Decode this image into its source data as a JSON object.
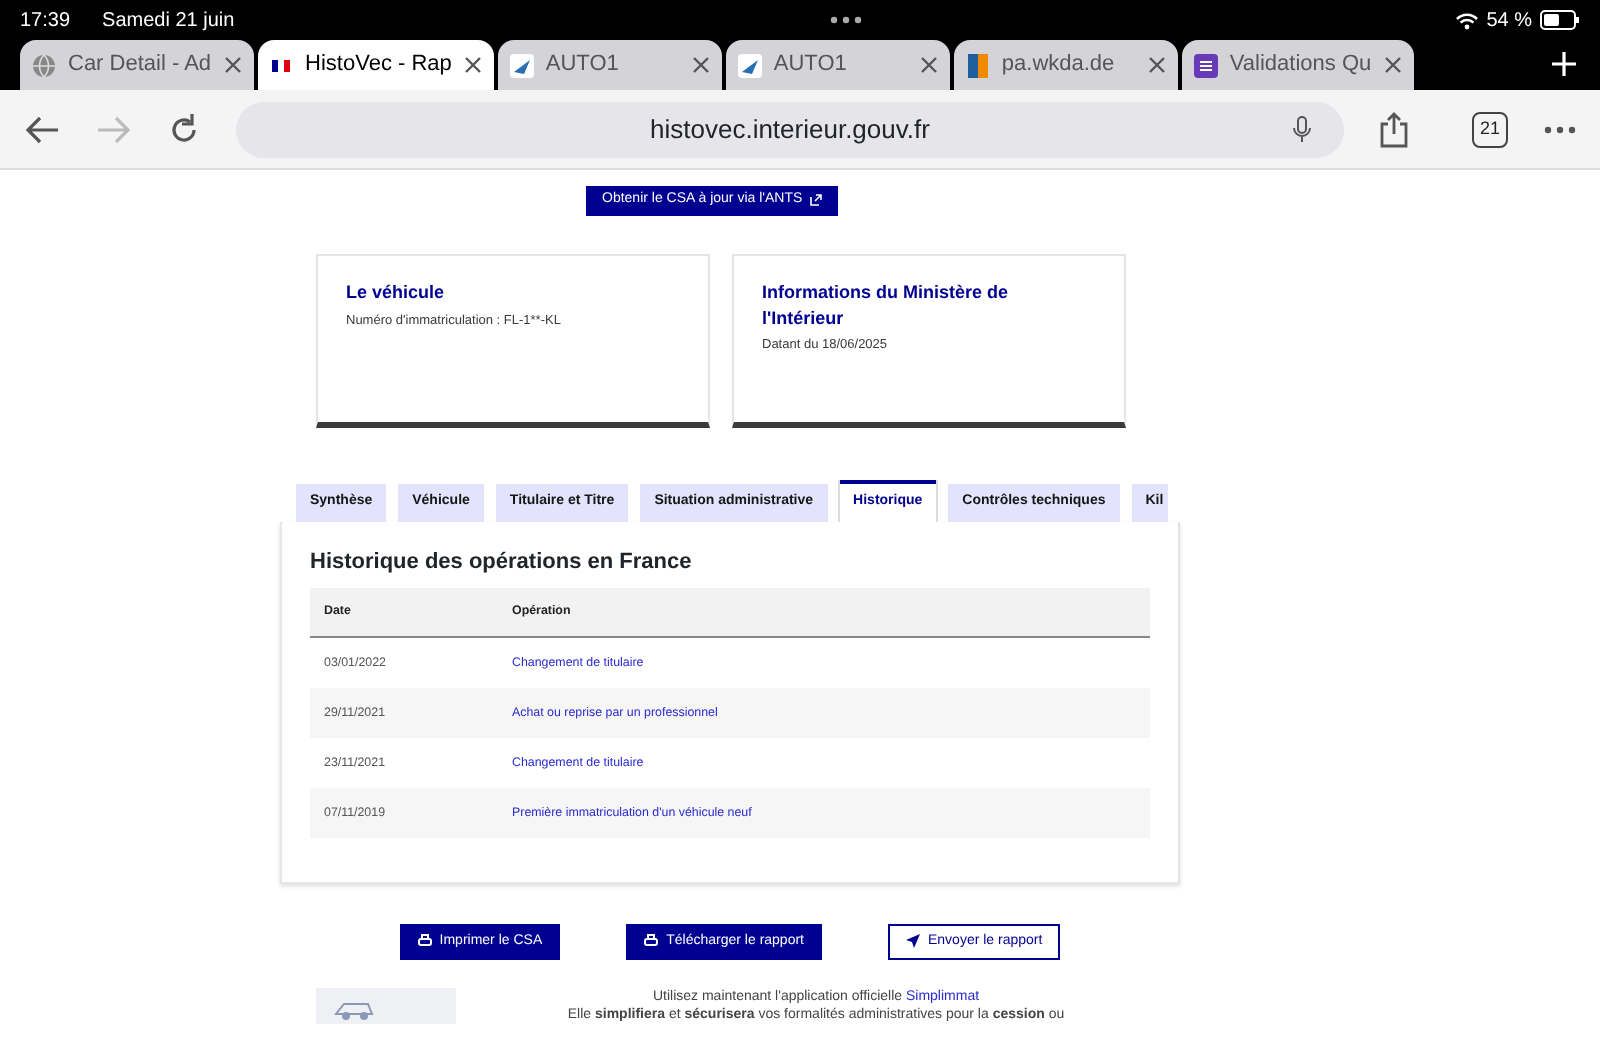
{
  "status_bar": {
    "time": "17:39",
    "date": "Samedi 21 juin",
    "battery": "54 %"
  },
  "browser_tabs": [
    {
      "title": "Car Detail - Ad",
      "selected": false,
      "kind": "globe"
    },
    {
      "title": "HistoVec - Rap",
      "selected": true,
      "kind": "flag"
    },
    {
      "title": "AUTO1",
      "selected": false,
      "kind": "auto"
    },
    {
      "title": "AUTO1",
      "selected": false,
      "kind": "auto"
    },
    {
      "title": "pa.wkda.de",
      "selected": false,
      "kind": "wkda"
    },
    {
      "title": "Validations Qu",
      "selected": false,
      "kind": "forms"
    }
  ],
  "address_bar": {
    "url": "histovec.interieur.gouv.fr",
    "tab_count": "21"
  },
  "ants_button": "Obtenir le CSA à jour via l'ANTS",
  "cards": [
    {
      "title": "Le véhicule",
      "text": "Numéro d'immatriculation : FL-1**-KL"
    },
    {
      "title": "Informations du Ministère de l'Intérieur",
      "text": "Datant du 18/06/2025"
    }
  ],
  "section_tabs": [
    {
      "label": "Synthèse",
      "selected": false
    },
    {
      "label": "Véhicule",
      "selected": false
    },
    {
      "label": "Titulaire et Titre",
      "selected": false
    },
    {
      "label": "Situation administrative",
      "selected": false
    },
    {
      "label": "Historique",
      "selected": true
    },
    {
      "label": "Contrôles techniques",
      "selected": false
    },
    {
      "label": "Kil",
      "selected": false
    }
  ],
  "history": {
    "title": "Historique des opérations en France",
    "columns": [
      "Date",
      "Opération"
    ],
    "rows": [
      {
        "date": "03/01/2022",
        "operation": "Changement de titulaire"
      },
      {
        "date": "29/11/2021",
        "operation": "Achat ou reprise par un professionnel"
      },
      {
        "date": "23/11/2021",
        "operation": "Changement de titulaire"
      },
      {
        "date": "07/11/2019",
        "operation": "Première immatriculation d'un véhicule neuf"
      }
    ]
  },
  "actions": [
    {
      "label": "Imprimer le CSA",
      "kind": "print"
    },
    {
      "label": "Télécharger le rapport",
      "kind": "print"
    },
    {
      "label": "Envoyer le rapport",
      "kind": "send"
    }
  ],
  "footer": {
    "intro": "Utilisez maintenant l'application officielle",
    "link": "Simplimmat",
    "line_2": "Elle **simplifiera** et **sécurisera** vos formalités administratives pour la **cession** ou"
  }
}
